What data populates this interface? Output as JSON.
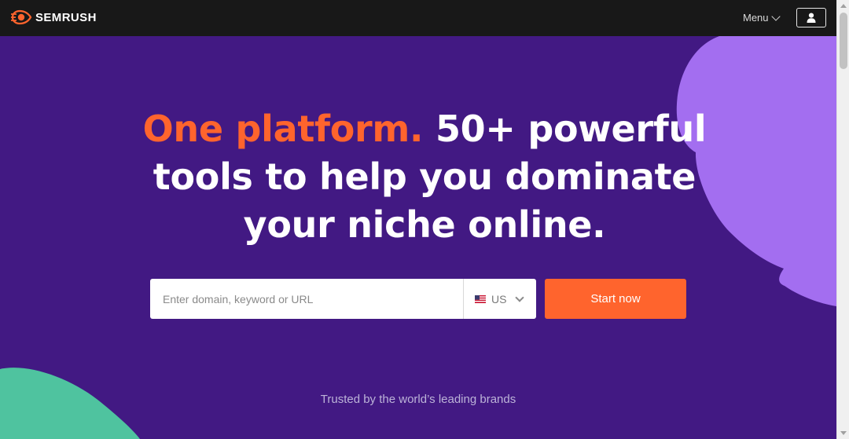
{
  "nav": {
    "logo_text": "SEMRUSH",
    "menu_label": "Menu",
    "user_icon": "user-icon"
  },
  "hero": {
    "headline_accent": "One platform.",
    "headline_rest": " 50+ powerful tools to help you dominate your niche online.",
    "search_placeholder": "Enter domain, keyword or URL",
    "country_code": "US",
    "country_flag_icon": "us-flag-icon",
    "cta_label": "Start now",
    "trusted_text": "Trusted by the world’s leading brands"
  },
  "colors": {
    "background": "#421983",
    "nav": "#181818",
    "accent": "#ff642d",
    "purple_shape": "#a36ef0",
    "green_shape": "#4fc39f"
  }
}
